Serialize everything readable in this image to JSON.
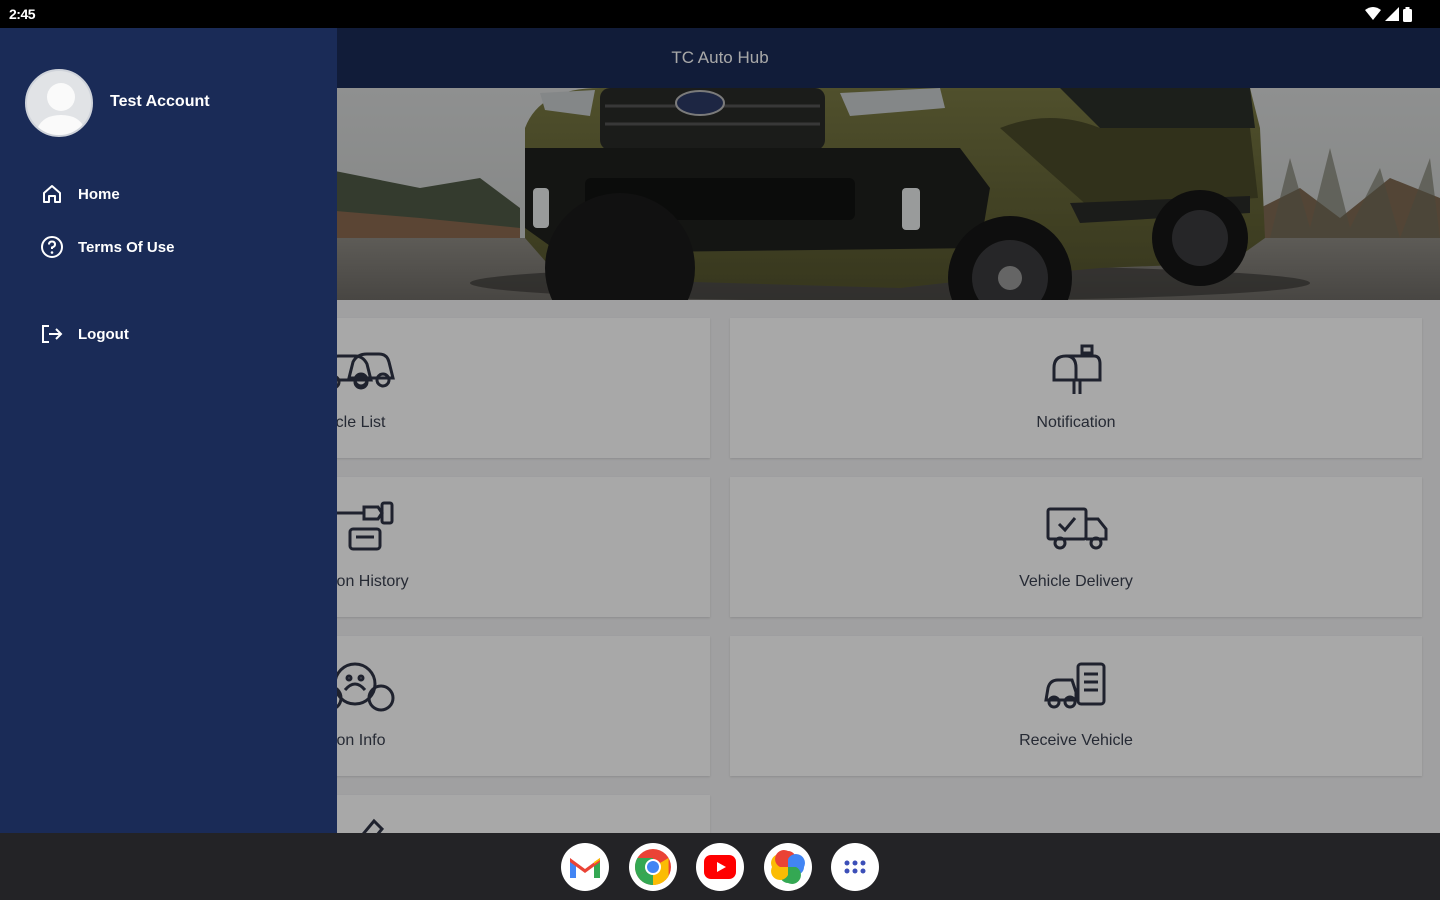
{
  "status_bar": {
    "time": "2:45",
    "icons": [
      "wifi-icon",
      "cell-signal-icon",
      "battery-icon"
    ]
  },
  "app": {
    "title": "TC Auto Hub",
    "colors": {
      "primary": "#1a2b57",
      "tile_bg": "#ffffff",
      "page_bg": "#f3f3f4",
      "label": "#3b4150"
    },
    "tiles": [
      {
        "label": "Vehicle List",
        "icon": "cars-icon"
      },
      {
        "label": "Notification",
        "icon": "mailbox-icon"
      },
      {
        "label": "Inspection History",
        "icon": "inspection-icon"
      },
      {
        "label": "Vehicle Delivery",
        "icon": "delivery-truck-icon"
      },
      {
        "label": "Station Info",
        "icon": "station-info-icon"
      },
      {
        "label": "Receive Vehicle",
        "icon": "receive-vehicle-icon"
      },
      {
        "label": "",
        "icon": "edit-icon"
      }
    ]
  },
  "drawer": {
    "profile": {
      "name": "Test Account",
      "avatar_icon": "user-avatar-icon"
    },
    "menu": [
      {
        "label": "Home",
        "icon": "home-icon"
      },
      {
        "label": "Terms Of Use",
        "icon": "help-circle-icon"
      }
    ],
    "logout_label": "Logout",
    "logout_icon": "logout-icon"
  },
  "dock": {
    "apps": [
      {
        "name": "Gmail",
        "icon": "gmail-icon"
      },
      {
        "name": "Chrome",
        "icon": "chrome-icon"
      },
      {
        "name": "YouTube",
        "icon": "youtube-icon"
      },
      {
        "name": "Photos",
        "icon": "photos-icon"
      },
      {
        "name": "App drawer",
        "icon": "app-drawer-icon"
      }
    ]
  }
}
